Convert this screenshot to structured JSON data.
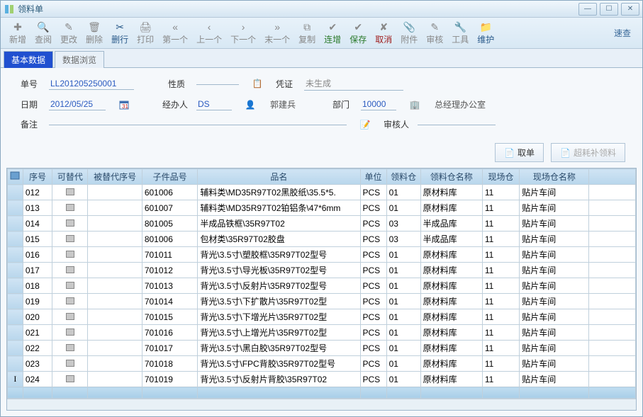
{
  "window": {
    "title": "领料单"
  },
  "toolbar": {
    "items": [
      {
        "label": "新增",
        "icon": "✚",
        "cls": ""
      },
      {
        "label": "查阅",
        "icon": "🔍",
        "cls": ""
      },
      {
        "label": "更改",
        "icon": "✎",
        "cls": ""
      },
      {
        "label": "删除",
        "icon": "🗑",
        "cls": ""
      },
      {
        "label": "删行",
        "icon": "✂",
        "cls": "active"
      },
      {
        "label": "打印",
        "icon": "🖨",
        "cls": ""
      },
      {
        "label": "第一个",
        "icon": "«",
        "cls": ""
      },
      {
        "label": "上一个",
        "icon": "‹",
        "cls": ""
      },
      {
        "label": "下一个",
        "icon": "›",
        "cls": ""
      },
      {
        "label": "末一个",
        "icon": "»",
        "cls": ""
      },
      {
        "label": "复制",
        "icon": "⧉",
        "cls": ""
      },
      {
        "label": "连增",
        "icon": "✔",
        "cls": "green"
      },
      {
        "label": "保存",
        "icon": "✔",
        "cls": "green"
      },
      {
        "label": "取消",
        "icon": "✘",
        "cls": "red"
      },
      {
        "label": "附件",
        "icon": "📎",
        "cls": ""
      },
      {
        "label": "审核",
        "icon": "✎",
        "cls": ""
      },
      {
        "label": "工具",
        "icon": "🔧",
        "cls": ""
      },
      {
        "label": "维护",
        "icon": "📁",
        "cls": "active"
      }
    ],
    "quick": "速查"
  },
  "tabs": {
    "basic": "基本数据",
    "browse": "数据浏览"
  },
  "form": {
    "no_label": "单号",
    "no_value": "LL201205250001",
    "nature_label": "性质",
    "nature_value": "",
    "voucher_label": "凭证",
    "voucher_value": "未生成",
    "date_label": "日期",
    "date_value": "2012/05/25",
    "handler_label": "经办人",
    "handler_code": "DS",
    "handler_name": "郭建兵",
    "dept_label": "部门",
    "dept_code": "10000",
    "dept_name": "总经理办公室",
    "remark_label": "备注",
    "remark_value": "",
    "auditor_label": "审核人",
    "auditor_value": ""
  },
  "buttons": {
    "take": "取单",
    "extra": "超耗补领料"
  },
  "grid": {
    "headers": [
      "",
      "序号",
      "可替代",
      "被替代序号",
      "子件品号",
      "品名",
      "单位",
      "领料仓",
      "领料仓名称",
      "现场仓",
      "现场仓名称",
      ""
    ],
    "widths": [
      20,
      38,
      46,
      70,
      72,
      210,
      34,
      44,
      80,
      48,
      90,
      60
    ],
    "rows": [
      {
        "seq": "012",
        "part": "601006",
        "name": "辅料类\\MD35R97T02黑胶纸\\35.5*5.",
        "unit": "PCS",
        "wh": "01",
        "whn": "原材料库",
        "fw": "11",
        "fwn": "贴片车间"
      },
      {
        "seq": "013",
        "part": "601007",
        "name": "辅料类\\MD35R97T02铂铝条\\47*6mm",
        "unit": "PCS",
        "wh": "01",
        "whn": "原材料库",
        "fw": "11",
        "fwn": "贴片车间"
      },
      {
        "seq": "014",
        "part": "801005",
        "name": "半成品铁框\\35R97T02",
        "unit": "PCS",
        "wh": "03",
        "whn": "半成品库",
        "fw": "11",
        "fwn": "贴片车间"
      },
      {
        "seq": "015",
        "part": "801006",
        "name": "包材类\\35R97T02胶盘",
        "unit": "PCS",
        "wh": "03",
        "whn": "半成品库",
        "fw": "11",
        "fwn": "贴片车间"
      },
      {
        "seq": "016",
        "part": "701011",
        "name": "背光\\3.5寸\\塑胶框\\35R97T02型号",
        "unit": "PCS",
        "wh": "01",
        "whn": "原材料库",
        "fw": "11",
        "fwn": "贴片车间"
      },
      {
        "seq": "017",
        "part": "701012",
        "name": "背光\\3.5寸\\导光板\\35R97T02型号",
        "unit": "PCS",
        "wh": "01",
        "whn": "原材料库",
        "fw": "11",
        "fwn": "贴片车间"
      },
      {
        "seq": "018",
        "part": "701013",
        "name": "背光\\3.5寸\\反射片\\35R97T02型号",
        "unit": "PCS",
        "wh": "01",
        "whn": "原材料库",
        "fw": "11",
        "fwn": "贴片车间"
      },
      {
        "seq": "019",
        "part": "701014",
        "name": "背光\\3.5寸\\下扩散片\\35R97T02型",
        "unit": "PCS",
        "wh": "01",
        "whn": "原材料库",
        "fw": "11",
        "fwn": "贴片车间"
      },
      {
        "seq": "020",
        "part": "701015",
        "name": "背光\\3.5寸\\下增光片\\35R97T02型",
        "unit": "PCS",
        "wh": "01",
        "whn": "原材料库",
        "fw": "11",
        "fwn": "贴片车间"
      },
      {
        "seq": "021",
        "part": "701016",
        "name": "背光\\3.5寸\\上增光片\\35R97T02型",
        "unit": "PCS",
        "wh": "01",
        "whn": "原材料库",
        "fw": "11",
        "fwn": "贴片车间"
      },
      {
        "seq": "022",
        "part": "701017",
        "name": "背光\\3.5寸\\黑白胶\\35R97T02型号",
        "unit": "PCS",
        "wh": "01",
        "whn": "原材料库",
        "fw": "11",
        "fwn": "贴片车间"
      },
      {
        "seq": "023",
        "part": "701018",
        "name": "背光\\3.5寸\\FPC背胶\\35R97T02型号",
        "unit": "PCS",
        "wh": "01",
        "whn": "原材料库",
        "fw": "11",
        "fwn": "贴片车间"
      },
      {
        "seq": "024",
        "part": "701019",
        "name": "背光\\3.5寸\\反射片背胶\\35R97T02",
        "unit": "PCS",
        "wh": "01",
        "whn": "原材料库",
        "fw": "11",
        "fwn": "贴片车间",
        "cursor": true
      }
    ]
  }
}
